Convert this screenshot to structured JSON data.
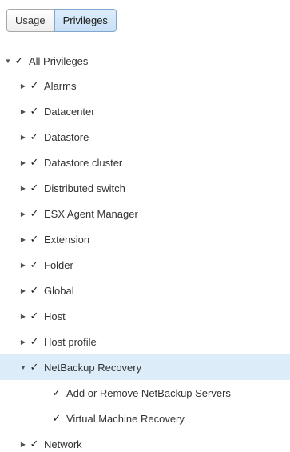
{
  "tabs": [
    {
      "label": "Usage",
      "active": false
    },
    {
      "label": "Privileges",
      "active": true
    }
  ],
  "icons": {
    "collapsed": "triangle-right-icon",
    "expanded": "triangle-down-icon",
    "check": "check-icon"
  },
  "colors": {
    "selected_row": "#dcecf9",
    "active_tab": "#c9e0f6"
  },
  "tree": {
    "root": {
      "label": "All Privileges",
      "expanded": true,
      "checked": true
    },
    "items": [
      {
        "label": "Alarms",
        "expanded": false,
        "checked": true
      },
      {
        "label": "Datacenter",
        "expanded": false,
        "checked": true
      },
      {
        "label": "Datastore",
        "expanded": false,
        "checked": true
      },
      {
        "label": "Datastore cluster",
        "expanded": false,
        "checked": true
      },
      {
        "label": "Distributed switch",
        "expanded": false,
        "checked": true
      },
      {
        "label": "ESX Agent Manager",
        "expanded": false,
        "checked": true
      },
      {
        "label": "Extension",
        "expanded": false,
        "checked": true
      },
      {
        "label": "Folder",
        "expanded": false,
        "checked": true
      },
      {
        "label": "Global",
        "expanded": false,
        "checked": true
      },
      {
        "label": "Host",
        "expanded": false,
        "checked": true
      },
      {
        "label": "Host profile",
        "expanded": false,
        "checked": true
      },
      {
        "label": "NetBackup Recovery",
        "expanded": true,
        "checked": true,
        "selected": true
      },
      {
        "label": "Add or Remove NetBackup Servers",
        "checked": true,
        "child": true
      },
      {
        "label": "Virtual Machine Recovery",
        "checked": true,
        "child": true
      },
      {
        "label": "Network",
        "expanded": false,
        "checked": true
      }
    ]
  }
}
